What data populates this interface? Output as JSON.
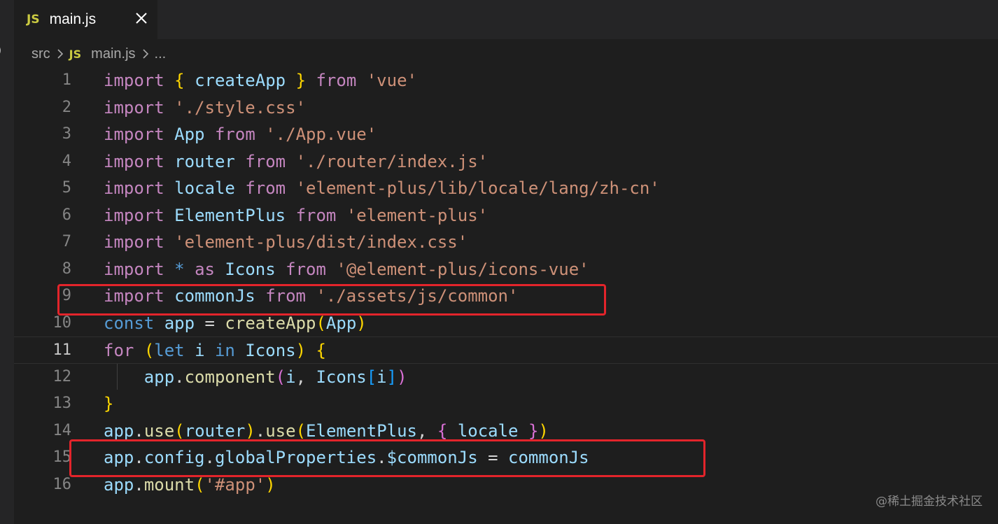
{
  "tab": {
    "icon": "JS",
    "label": "main.js",
    "close_icon": "close-icon"
  },
  "breadcrumb": {
    "folder": "src",
    "file_icon": "JS",
    "file": "main.js",
    "more": "..."
  },
  "left_strip_glyph": ")",
  "editor": {
    "active_line": 11,
    "lines": [
      {
        "num": "1"
      },
      {
        "num": "2"
      },
      {
        "num": "3"
      },
      {
        "num": "4"
      },
      {
        "num": "5"
      },
      {
        "num": "6"
      },
      {
        "num": "7"
      },
      {
        "num": "8"
      },
      {
        "num": "9"
      },
      {
        "num": "10"
      },
      {
        "num": "11"
      },
      {
        "num": "12"
      },
      {
        "num": "13"
      },
      {
        "num": "14"
      },
      {
        "num": "15"
      },
      {
        "num": "16"
      }
    ],
    "code": [
      [
        [
          "kw",
          "import"
        ],
        [
          "pl",
          " "
        ],
        [
          "b1",
          "{"
        ],
        [
          "pl",
          " "
        ],
        [
          "id",
          "createApp"
        ],
        [
          "pl",
          " "
        ],
        [
          "b1",
          "}"
        ],
        [
          "pl",
          " "
        ],
        [
          "kw",
          "from"
        ],
        [
          "pl",
          " "
        ],
        [
          "str",
          "'vue'"
        ]
      ],
      [
        [
          "kw",
          "import"
        ],
        [
          "pl",
          " "
        ],
        [
          "str",
          "'./style.css'"
        ]
      ],
      [
        [
          "kw",
          "import"
        ],
        [
          "pl",
          " "
        ],
        [
          "id",
          "App"
        ],
        [
          "pl",
          " "
        ],
        [
          "kw",
          "from"
        ],
        [
          "pl",
          " "
        ],
        [
          "str",
          "'./App.vue'"
        ]
      ],
      [
        [
          "kw",
          "import"
        ],
        [
          "pl",
          " "
        ],
        [
          "id",
          "router"
        ],
        [
          "pl",
          " "
        ],
        [
          "kw",
          "from"
        ],
        [
          "pl",
          " "
        ],
        [
          "str",
          "'./router/index.js'"
        ]
      ],
      [
        [
          "kw",
          "import"
        ],
        [
          "pl",
          " "
        ],
        [
          "id",
          "locale"
        ],
        [
          "pl",
          " "
        ],
        [
          "kw",
          "from"
        ],
        [
          "pl",
          " "
        ],
        [
          "str",
          "'element-plus/lib/locale/lang/zh-cn'"
        ]
      ],
      [
        [
          "kw",
          "import"
        ],
        [
          "pl",
          " "
        ],
        [
          "id",
          "ElementPlus"
        ],
        [
          "pl",
          " "
        ],
        [
          "kw",
          "from"
        ],
        [
          "pl",
          " "
        ],
        [
          "str",
          "'element-plus'"
        ]
      ],
      [
        [
          "kw",
          "import"
        ],
        [
          "pl",
          " "
        ],
        [
          "str",
          "'element-plus/dist/index.css'"
        ]
      ],
      [
        [
          "kw",
          "import"
        ],
        [
          "pl",
          " "
        ],
        [
          "kwb",
          "*"
        ],
        [
          "pl",
          " "
        ],
        [
          "kw",
          "as"
        ],
        [
          "pl",
          " "
        ],
        [
          "id",
          "Icons"
        ],
        [
          "pl",
          " "
        ],
        [
          "kw",
          "from"
        ],
        [
          "pl",
          " "
        ],
        [
          "str",
          "'@element-plus/icons-vue'"
        ]
      ],
      [
        [
          "kw",
          "import"
        ],
        [
          "pl",
          " "
        ],
        [
          "id",
          "commonJs"
        ],
        [
          "pl",
          " "
        ],
        [
          "kw",
          "from"
        ],
        [
          "pl",
          " "
        ],
        [
          "str",
          "'./assets/js/common'"
        ]
      ],
      [
        [
          "kwb",
          "const"
        ],
        [
          "pl",
          " "
        ],
        [
          "id",
          "app"
        ],
        [
          "pl",
          " = "
        ],
        [
          "fn",
          "createApp"
        ],
        [
          "b1",
          "("
        ],
        [
          "id",
          "App"
        ],
        [
          "b1",
          ")"
        ]
      ],
      [
        [
          "kw",
          "for"
        ],
        [
          "pl",
          " "
        ],
        [
          "b1",
          "("
        ],
        [
          "kwb",
          "let"
        ],
        [
          "pl",
          " "
        ],
        [
          "id",
          "i"
        ],
        [
          "pl",
          " "
        ],
        [
          "kwb",
          "in"
        ],
        [
          "pl",
          " "
        ],
        [
          "id",
          "Icons"
        ],
        [
          "b1",
          ")"
        ],
        [
          "pl",
          " "
        ],
        [
          "b1",
          "{"
        ]
      ],
      [
        [
          "pl",
          "    "
        ],
        [
          "id",
          "app"
        ],
        [
          "pl",
          "."
        ],
        [
          "fn",
          "component"
        ],
        [
          "b2",
          "("
        ],
        [
          "id",
          "i"
        ],
        [
          "pl",
          ", "
        ],
        [
          "id",
          "Icons"
        ],
        [
          "b3",
          "["
        ],
        [
          "id",
          "i"
        ],
        [
          "b3",
          "]"
        ],
        [
          "b2",
          ")"
        ]
      ],
      [
        [
          "b1",
          "}"
        ]
      ],
      [
        [
          "id",
          "app"
        ],
        [
          "pl",
          "."
        ],
        [
          "fn",
          "use"
        ],
        [
          "b1",
          "("
        ],
        [
          "id",
          "router"
        ],
        [
          "b1",
          ")"
        ],
        [
          "pl",
          "."
        ],
        [
          "fn",
          "use"
        ],
        [
          "b1",
          "("
        ],
        [
          "id",
          "ElementPlus"
        ],
        [
          "pl",
          ", "
        ],
        [
          "b2",
          "{"
        ],
        [
          "pl",
          " "
        ],
        [
          "id",
          "locale"
        ],
        [
          "pl",
          " "
        ],
        [
          "b2",
          "}"
        ],
        [
          "b1",
          ")"
        ]
      ],
      [
        [
          "id",
          "app"
        ],
        [
          "pl",
          "."
        ],
        [
          "id",
          "config"
        ],
        [
          "pl",
          "."
        ],
        [
          "id",
          "globalProperties"
        ],
        [
          "pl",
          "."
        ],
        [
          "id",
          "$commonJs"
        ],
        [
          "pl",
          " = "
        ],
        [
          "id",
          "commonJs"
        ]
      ],
      [
        [
          "id",
          "app"
        ],
        [
          "pl",
          "."
        ],
        [
          "fn",
          "mount"
        ],
        [
          "b1",
          "("
        ],
        [
          "str",
          "'#app'"
        ],
        [
          "b1",
          ")"
        ]
      ]
    ]
  },
  "annotations": {
    "highlight_lines": [
      9,
      15
    ]
  },
  "watermark": "@稀土掘金技术社区",
  "colors": {
    "editor_bg": "#1e1e1e",
    "tab_bar_bg": "#252526",
    "keyword_control": "#c586c0",
    "keyword_storage": "#569cd6",
    "string": "#ce9178",
    "variable": "#9cdcfe",
    "function": "#dcdcaa",
    "bracket_1": "#ffd700",
    "bracket_2": "#da70d6",
    "bracket_3": "#179fff",
    "annotation_red": "#e3242b",
    "js_icon": "#cbcb41"
  }
}
